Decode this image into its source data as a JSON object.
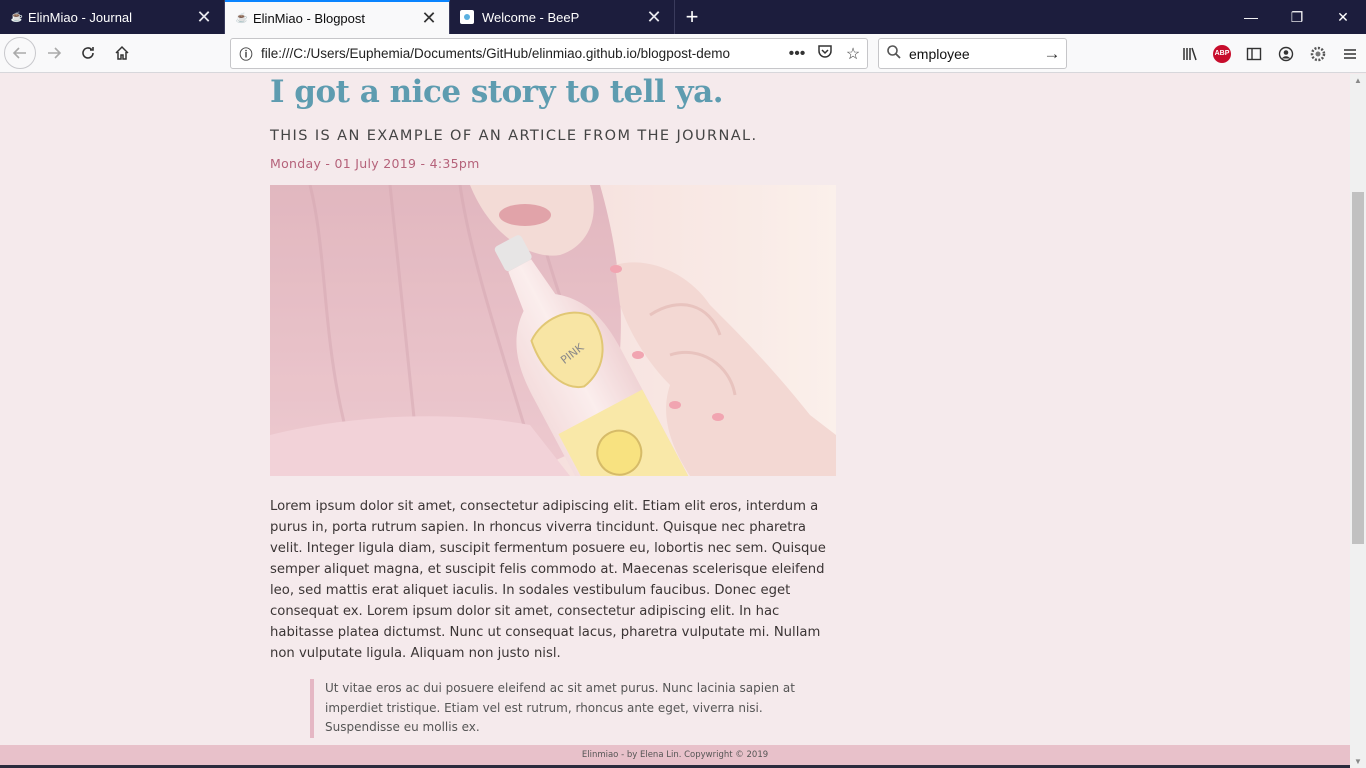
{
  "browser": {
    "tabs": [
      {
        "title": "ElinMiao - Journal",
        "favicon": "teapot-icon",
        "active": false
      },
      {
        "title": "ElinMiao - Blogpost",
        "favicon": "teapot-icon",
        "active": true
      },
      {
        "title": "Welcome - BeeP",
        "favicon": "bee-icon",
        "active": false
      }
    ],
    "url": "file:///C:/Users/Euphemia/Documents/GitHub/elinmiao.github.io/blogpost-demo",
    "search_value": "employee",
    "accent_color": "#0a84ff",
    "tabbar_color": "#1c1d3d"
  },
  "article": {
    "title": "I got a nice story to tell ya.",
    "subtitle": "THIS IS AN EXAMPLE OF AN ARTICLE FROM THE JOURNAL.",
    "date": "Monday - 01 July 2019 - 4:35pm",
    "body": "Lorem ipsum dolor sit amet, consectetur adipiscing elit. Etiam elit eros, interdum a purus in, porta rutrum sapien. In rhoncus viverra tincidunt. Quisque nec pharetra velit. Integer ligula diam, suscipit fermentum posuere eu, lobortis nec sem. Quisque semper aliquet magna, et suscipit felis commodo at. Maecenas scelerisque eleifend leo, sed mattis erat aliquet iaculis. In sodales vestibulum faucibus. Donec eget consequat ex. Lorem ipsum dolor sit amet, consectetur adipiscing elit. In hac habitasse platea dictumst. Nunc ut consequat lacus, pharetra vulputate mi. Nullam non vulputate ligula. Aliquam non justo nisl.",
    "quote": "Ut vitae eros ac dui posuere eleifend ac sit amet purus. Nunc lacinia sapien at imperdiet tristique. Etiam vel est rutrum, rhoncus ante eget, viverra nisi. Suspendisse eu mollis ex.",
    "title_color": "#5e9cb0",
    "date_color": "#b5627a"
  },
  "footer": {
    "text": "Elinmiao - by Elena Lin. Copywright © 2019"
  }
}
